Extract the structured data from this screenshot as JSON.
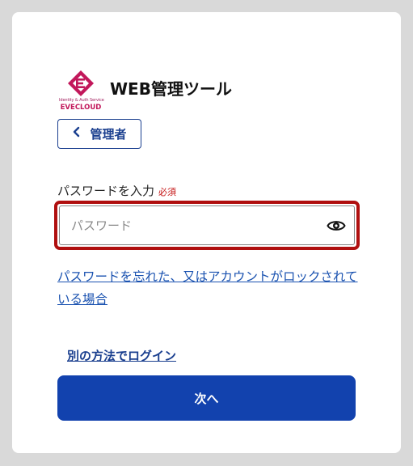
{
  "logo": {
    "small_text": "Identity & Auth Service",
    "brand": "EVECLOUD",
    "brand_color": "#c2185b"
  },
  "app_title": "WEB管理ツール",
  "back_button": {
    "label": "管理者",
    "icon": "chevron-left-icon"
  },
  "password_field": {
    "label": "パスワードを入力",
    "required_badge": "必須",
    "placeholder": "パスワード",
    "value": "",
    "toggle_icon": "eye-icon",
    "border_color": "#b00f0f"
  },
  "forgot_link": "パスワードを忘れた、又はアカウントがロックされている場合",
  "alt_login_link": "別の方法でログイン",
  "next_button": {
    "label": "次へ",
    "color": "#1242ae"
  }
}
